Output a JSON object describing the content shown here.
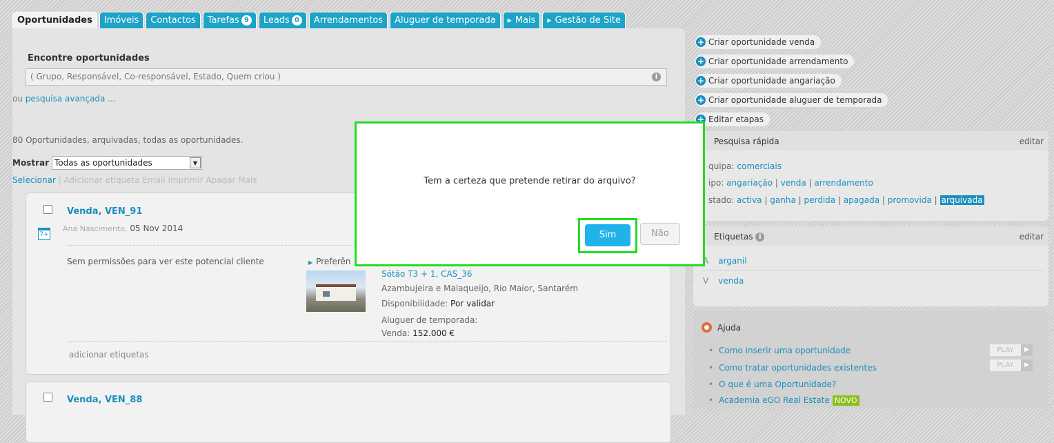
{
  "tabs": [
    {
      "label": "Oportunidades",
      "active": true
    },
    {
      "label": "Imóveis"
    },
    {
      "label": "Contactos"
    },
    {
      "label": "Tarefas",
      "badge": "9"
    },
    {
      "label": "Leads",
      "badge": "0"
    },
    {
      "label": "Arrendamentos"
    },
    {
      "label": "Aluguer de temporada"
    },
    {
      "label": "Mais",
      "arrow": true
    },
    {
      "label": "Gestão de Site",
      "arrow": true
    }
  ],
  "search": {
    "title": "Encontre oportunidades",
    "placeholder": "( Grupo, Responsável, Co-responsável, Estado, Quem criou )",
    "or_text": "ou ",
    "advanced_link": "pesquisa avançada ..."
  },
  "list": {
    "count_text": "80 Oportunidades, arquivadas, todas as oportunidades.",
    "show_label": "Mostrar",
    "show_value": "Todas as oportunidades",
    "actions": {
      "select": "Selecionar",
      "separator": " | ",
      "rest": "Adicionar etiqueta Email Imprimir Apagar Mais"
    }
  },
  "cards": [
    {
      "title": "Venda, VEN_91",
      "author": "Ana Nascimento,",
      "date": "05 Nov 2014",
      "calendar": "7+",
      "no_perm": "Sem permissões para ver este potencial cliente",
      "pref": "Preferên",
      "property": {
        "title": "Sótão T3 + 1, CAS_36",
        "location": "Azambujeira e Malaqueijo, Rio Maior, Santarém",
        "availability_label": "Disponibilidade: ",
        "availability_value": "Por validar",
        "seasonal_label": "Aluguer de temporada:",
        "sale_label": "Venda: ",
        "sale_value": "152.000 €"
      },
      "add_tags": "adicionar etiquetas"
    },
    {
      "title": "Venda, VEN_88"
    }
  ],
  "right": {
    "create_buttons": [
      "Criar oportunidade venda",
      "Criar oportunidade arrendamento",
      "Criar oportunidade angariação",
      "Criar oportunidade aluguer de temporada",
      "Editar etapas"
    ],
    "quick_search": {
      "title": "Pesquisa rápida",
      "edit": "editar",
      "team_label": "quipa: ",
      "team_value": "comerciais",
      "type_label": "ipo: ",
      "type_values": [
        "angariação",
        "venda",
        "arrendamento"
      ],
      "state_label": "stado: ",
      "state_values": [
        "activa",
        "ganha",
        "perdida",
        "apagada",
        "promovida"
      ],
      "state_highlight": "arquivada",
      "sep": " | "
    },
    "tags": {
      "title": "Etiquetas",
      "edit": "editar",
      "rows": [
        {
          "letter": "A",
          "value": "arganil"
        },
        {
          "letter": "V",
          "value": "venda"
        }
      ]
    },
    "help": {
      "title": "Ajuda",
      "items": [
        "Como inserir uma oportunidade",
        "Como tratar oportunidades existentes",
        "O que é uma Oportunidade?",
        "Academia eGO Real Estate"
      ],
      "play_label": "PLAY",
      "new_badge": "NOVO"
    }
  },
  "modal": {
    "message": "Tem a certeza que pretende retirar do arquivo?",
    "yes": "Sim",
    "no": "Não"
  },
  "colors": {
    "accent": "#1ca3c7",
    "link": "#1a8fbf",
    "highlight_border": "#22dd22",
    "yes_button": "#1fb3ea"
  }
}
